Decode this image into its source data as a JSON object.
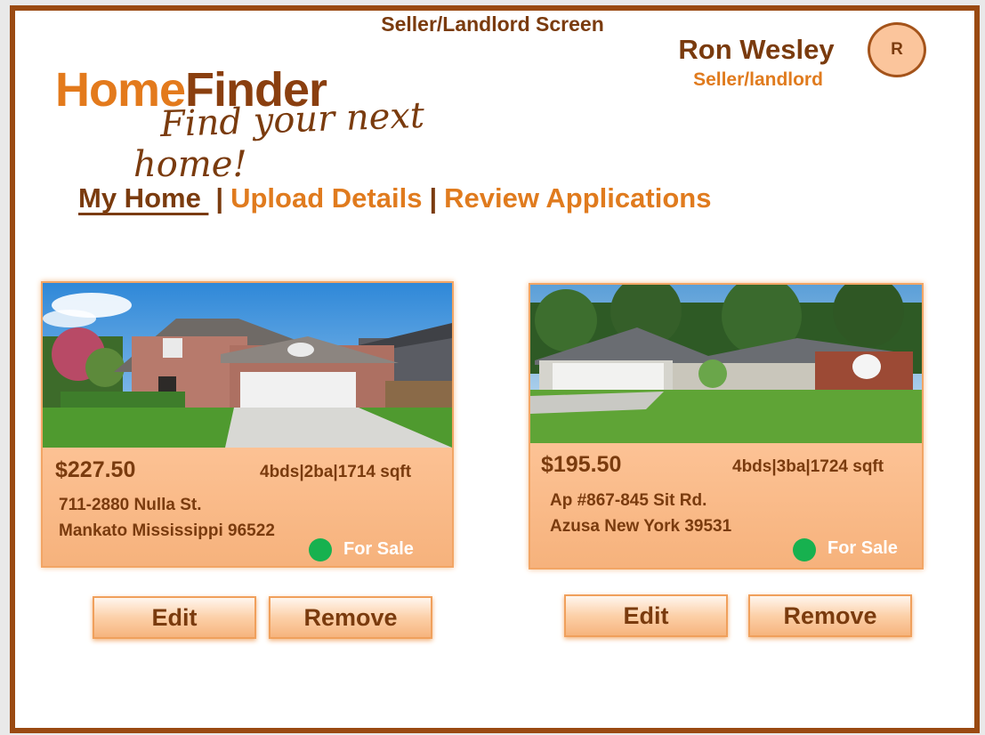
{
  "screen_title": "Seller/Landlord Screen",
  "user": {
    "name": "Ron Wesley",
    "role": "Seller/landlord",
    "avatar_initial": "R"
  },
  "logo": {
    "home": "Home",
    "finder": "Finder"
  },
  "tagline": {
    "line1": "Find your next",
    "line2": "home!"
  },
  "nav": {
    "items": [
      {
        "label": "My Home "
      },
      {
        "label": "Upload Details"
      },
      {
        "label": "Review Applications"
      }
    ],
    "separator": "|"
  },
  "listings": [
    {
      "price": "$227.50",
      "specs": "4bds|2ba|1714 sqft",
      "address_line1": "711-2880 Nulla St.",
      "address_line2": "Mankato Mississippi 96522",
      "status": "For Sale",
      "status_color": "#17b14f",
      "edit_label": "Edit",
      "remove_label": "Remove"
    },
    {
      "price": "$195.50",
      "specs": "4bds|3ba|1724 sqft",
      "address_line1": "Ap #867-845 Sit Rd.",
      "address_line2": "Azusa New York 39531",
      "status": "For Sale",
      "status_color": "#17b14f",
      "edit_label": "Edit",
      "remove_label": "Remove"
    }
  ],
  "colors": {
    "brand_dark": "#7a3b0e",
    "brand_orange": "#e07b1e",
    "frame": "#9a4a12"
  }
}
